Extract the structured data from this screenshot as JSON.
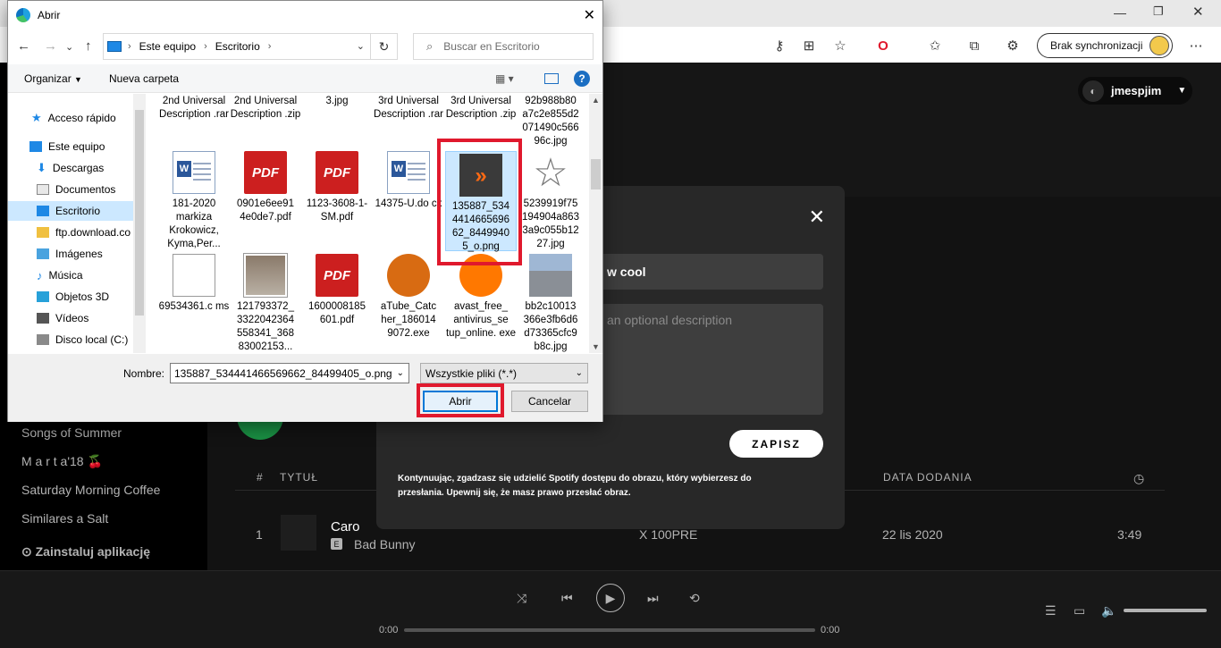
{
  "browser": {
    "sync_label": "Brak synchronizacji"
  },
  "spotify": {
    "username": "jmespjim",
    "playlists": [
      "Songs of Summer",
      "M a r t a'18 🍒",
      "Saturday Morning Coffee",
      "Similares a Salt"
    ],
    "install": "Zainstaluj aplikację",
    "modal": {
      "name_value": "w cool",
      "desc_placeholder": "an optional description",
      "save": "ZAPISZ",
      "disclaimer": "Kontynuując, zgadzasz się udzielić Spotify dostępu do obrazu, który wybierzesz do przesłania. Upewnij się, że masz prawo przesłać obraz."
    },
    "table": {
      "col_num": "#",
      "col_title": "TYTUŁ",
      "col_date": "DATA DODANIA",
      "row": {
        "num": "1",
        "title": "Caro",
        "artist": "Bad Bunny",
        "explicit": "E",
        "album": "X 100PRE",
        "date": "22 lis 2020",
        "duration": "3:49"
      }
    },
    "player": {
      "elapsed": "0:00",
      "total": "0:00"
    }
  },
  "dialog": {
    "title": "Abrir",
    "path": [
      "Este equipo",
      "Escritorio"
    ],
    "search_placeholder": "Buscar en Escritorio",
    "organize": "Organizar",
    "new_folder": "Nueva carpeta",
    "help": "?",
    "nav": [
      "Acceso rápido",
      "Este equipo",
      "Descargas",
      "Documentos",
      "Escritorio",
      "ftp.download.co",
      "Imágenes",
      "Música",
      "Objetos 3D",
      "Vídeos",
      "Disco local (C:)"
    ],
    "files_row0": [
      "2nd Universal Description .rar",
      "2nd Universal Description .zip",
      "3.jpg",
      "3rd Universal Description .rar",
      "3rd Universal Description .zip",
      "92b988b80 a7c2e855d2 071490c566 96c.jpg"
    ],
    "files_row1": [
      "181-2020 markiza Krokowicz, Kyma,Per...",
      "0901e6ee91 4e0de7.pdf",
      "1123-3608-1-SM.pdf",
      "14375-U.do cx",
      "135887_534 4414665696 62_8449940 5_o.png",
      "5239919f75 194904a863 3a9c055b12 27.jpg"
    ],
    "files_row2": [
      "69534361.c ms",
      "121793372_ 3322042364 558341_368 83002153...",
      "1600008185 601.pdf",
      "aTube_Catc her_186014 9072.exe",
      "avast_free_ antivirus_se tup_online. exe",
      "bb2c10013 366e3fb6d6 d73365cfc9 b8c.jpg"
    ],
    "name_label": "Nombre:",
    "name_value": "135887_534441466569662_84499405_o.png",
    "type_value": "Wszystkie pliki (*.*)",
    "open": "Abrir",
    "cancel": "Cancelar"
  }
}
